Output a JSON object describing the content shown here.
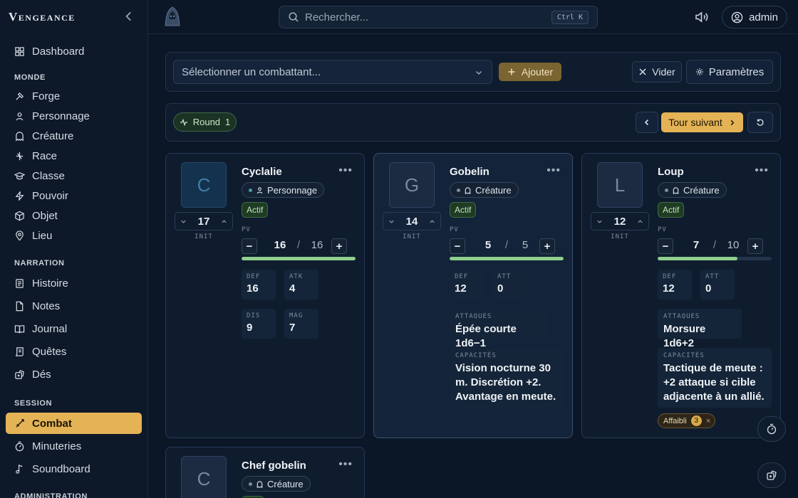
{
  "app": {
    "brand": "Vengeance"
  },
  "sidebar": {
    "top_items": [
      {
        "label": "Dashboard",
        "icon": "grid-icon"
      }
    ],
    "sections": [
      {
        "title": "MONDE",
        "items": [
          {
            "label": "Forge"
          },
          {
            "label": "Personnage"
          },
          {
            "label": "Créature"
          },
          {
            "label": "Race"
          },
          {
            "label": "Classe"
          },
          {
            "label": "Pouvoir"
          },
          {
            "label": "Objet"
          },
          {
            "label": "Lieu"
          }
        ]
      },
      {
        "title": "NARRATION",
        "items": [
          {
            "label": "Histoire"
          },
          {
            "label": "Notes"
          },
          {
            "label": "Journal"
          },
          {
            "label": "Quêtes"
          },
          {
            "label": "Dés"
          }
        ]
      },
      {
        "title": "SESSION",
        "items": [
          {
            "label": "Combat",
            "active": true
          },
          {
            "label": "Minuteries"
          },
          {
            "label": "Soundboard"
          }
        ]
      },
      {
        "title": "ADMINISTRATION",
        "items": []
      }
    ]
  },
  "topbar": {
    "search_placeholder": "Rechercher...",
    "search_shortcut": "Ctrl K",
    "user_label": "admin"
  },
  "combat": {
    "select_placeholder": "Sélectionner un combattant...",
    "add_label": "Ajouter",
    "clear_label": "Vider",
    "settings_label": "Paramètres",
    "round_label": "Round",
    "round_number": "1",
    "next_turn_label": "Tour suivant",
    "init_label": "INIT",
    "pv_label": "PV",
    "attacks_label": "ATTAQUES",
    "abilities_label": "CAPACITÉS"
  },
  "combatants": [
    {
      "initial": "C",
      "name": "Cyclalie",
      "type": "Personnage",
      "status": "Actif",
      "init": "17",
      "pv_current": "16",
      "pv_max": "16",
      "pv_fraction": 1.0,
      "stats": [
        {
          "k": "DEF",
          "v": "16"
        },
        {
          "k": "ATK",
          "v": "4"
        },
        {
          "k": "DIS",
          "v": "9"
        },
        {
          "k": "MAG",
          "v": "7"
        }
      ]
    },
    {
      "initial": "G",
      "name": "Gobelin",
      "type": "Créature",
      "status": "Actif",
      "init": "14",
      "pv_current": "5",
      "pv_max": "5",
      "pv_fraction": 1.0,
      "stats": [
        {
          "k": "DEF",
          "v": "12"
        },
        {
          "k": "ATT",
          "v": "0"
        }
      ],
      "attacks": "Épée courte 1d6−1",
      "abilities_lines": [
        "Vision nocturne 30",
        "m. Discrétion +2.",
        "Avantage en meute."
      ]
    },
    {
      "initial": "L",
      "name": "Loup",
      "type": "Créature",
      "status": "Actif",
      "init": "12",
      "pv_current": "7",
      "pv_max": "10",
      "pv_fraction": 0.7,
      "stats": [
        {
          "k": "DEF",
          "v": "12"
        },
        {
          "k": "ATT",
          "v": "0"
        }
      ],
      "attacks": "Morsure 1d6+2",
      "abilities_lines": [
        "Tactique de meute :",
        "+2 attaque si cible",
        "adjacente à un allié."
      ],
      "effect": {
        "label": "Affaibli",
        "count": "3",
        "close": "×"
      }
    },
    {
      "initial": "C",
      "name": "Chef gobelin",
      "type": "Créature"
    }
  ],
  "colors": {
    "accent": "#e4b356",
    "hp_bar": "#8fd08c",
    "background": "#0b1626"
  }
}
